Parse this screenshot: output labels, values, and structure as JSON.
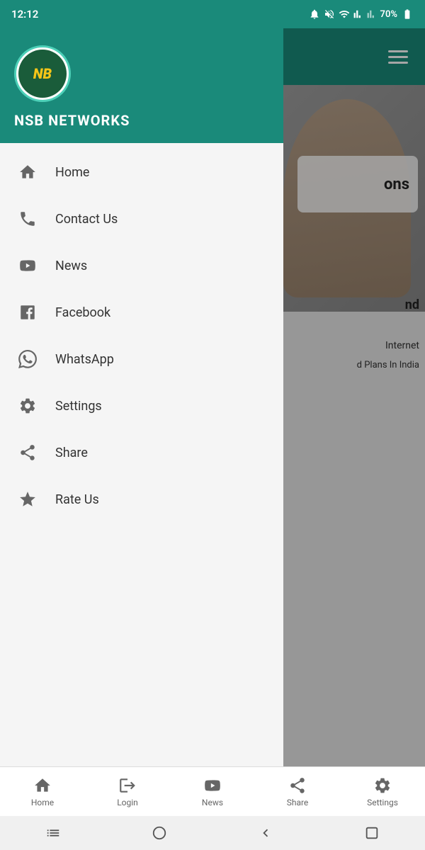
{
  "statusBar": {
    "time": "12:12",
    "batteryPercent": "70%",
    "icons": [
      "alarm",
      "mute",
      "wifi",
      "signal1",
      "signal2"
    ]
  },
  "sidebar": {
    "appName": "NSB NETWORKS",
    "logoText": "NB",
    "navItems": [
      {
        "id": "home",
        "label": "Home",
        "icon": "home"
      },
      {
        "id": "contact-us",
        "label": "Contact Us",
        "icon": "phone"
      },
      {
        "id": "news",
        "label": "News",
        "icon": "youtube"
      },
      {
        "id": "facebook",
        "label": "Facebook",
        "icon": "facebook"
      },
      {
        "id": "whatsapp",
        "label": "WhatsApp",
        "icon": "whatsapp"
      },
      {
        "id": "settings",
        "label": "Settings",
        "icon": "settings"
      },
      {
        "id": "share",
        "label": "Share",
        "icon": "share"
      },
      {
        "id": "rate-us",
        "label": "Rate Us",
        "icon": "star"
      }
    ]
  },
  "backgroundContent": {
    "cardText": "ons",
    "text1": "nd",
    "text2": "Internet",
    "text3": "d Plans In India"
  },
  "bottomNav": {
    "items": [
      {
        "id": "home",
        "label": "Home",
        "icon": "home"
      },
      {
        "id": "login",
        "label": "Login",
        "icon": "login"
      },
      {
        "id": "news",
        "label": "News",
        "icon": "youtube"
      },
      {
        "id": "share",
        "label": "Share",
        "icon": "share"
      },
      {
        "id": "settings",
        "label": "Settings",
        "icon": "settings"
      }
    ]
  }
}
